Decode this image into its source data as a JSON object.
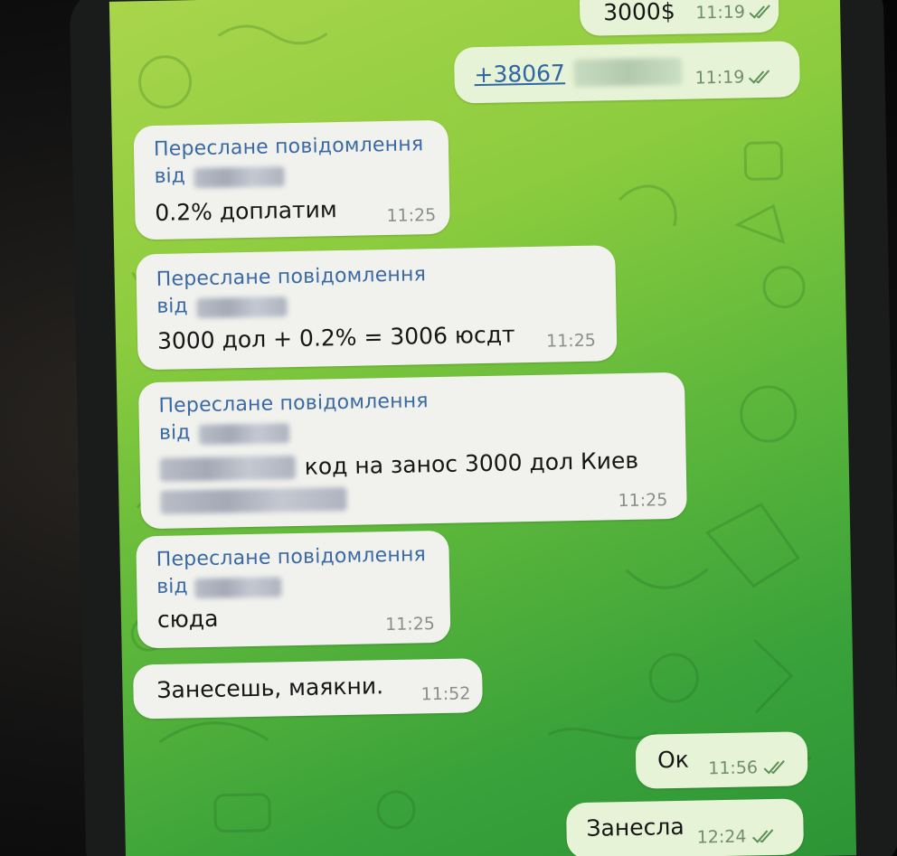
{
  "messages": [
    {
      "id": "m1",
      "direction": "out",
      "text": "3000$",
      "time": "11:19",
      "status": "read"
    },
    {
      "id": "m2",
      "direction": "out",
      "link": "+38067",
      "time": "11:19",
      "status": "read"
    },
    {
      "id": "m3",
      "direction": "in",
      "forwarded_label": "Переслане повідомлення",
      "from_prefix": "від",
      "text": "0.2% доплатим",
      "time": "11:25"
    },
    {
      "id": "m4",
      "direction": "in",
      "forwarded_label": "Переслане повідомлення",
      "from_prefix": "від",
      "text": "3000 дол  + 0.2% = 3006 юсдт",
      "time": "11:25"
    },
    {
      "id": "m5",
      "direction": "in",
      "forwarded_label": "Переслане повідомлення",
      "from_prefix": "від",
      "text": "код на занос 3000 дол Киев",
      "time": "11:25"
    },
    {
      "id": "m6",
      "direction": "in",
      "forwarded_label": "Переслане повідомлення",
      "from_prefix": "від",
      "text": "сюда",
      "time": "11:25"
    },
    {
      "id": "m7",
      "direction": "in",
      "text": "Занесешь, маякни.",
      "time": "11:52"
    },
    {
      "id": "m8",
      "direction": "out",
      "text": "Ок",
      "time": "11:56",
      "status": "read"
    },
    {
      "id": "m9",
      "direction": "out",
      "text": "Занесла",
      "time": "12:24",
      "status": "read"
    }
  ],
  "colors": {
    "chat_bg_top": "#a9d54b",
    "chat_bg_bottom": "#2d9436",
    "bubble_in": "#f1f2ee",
    "bubble_out": "#e7f3d6",
    "forward_label": "#3a69a3",
    "read_ticks": "#5a8f55"
  },
  "icons": {
    "read_status": "double-check-icon"
  }
}
